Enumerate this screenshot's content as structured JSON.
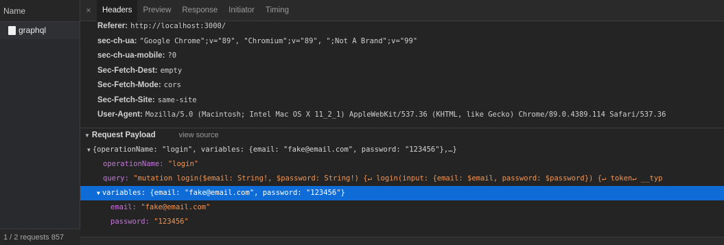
{
  "left": {
    "name_header": "Name",
    "requests": [
      {
        "name": "graphql"
      }
    ],
    "status": "1 / 2 requests  857"
  },
  "tabs": {
    "close": "×",
    "items": [
      "Headers",
      "Preview",
      "Response",
      "Initiator",
      "Timing"
    ],
    "active": "Headers"
  },
  "headers": [
    {
      "key": "Referer:",
      "value": "http://localhost:3000/"
    },
    {
      "key": "sec-ch-ua:",
      "value": "\"Google Chrome\";v=\"89\", \"Chromium\";v=\"89\", \";Not A Brand\";v=\"99\""
    },
    {
      "key": "sec-ch-ua-mobile:",
      "value": "?0"
    },
    {
      "key": "Sec-Fetch-Dest:",
      "value": "empty"
    },
    {
      "key": "Sec-Fetch-Mode:",
      "value": "cors"
    },
    {
      "key": "Sec-Fetch-Site:",
      "value": "same-site"
    },
    {
      "key": "User-Agent:",
      "value": "Mozilla/5.0 (Macintosh; Intel Mac OS X 11_2_1) AppleWebKit/537.36 (KHTML, like Gecko) Chrome/89.0.4389.114 Safari/537.36"
    }
  ],
  "payload": {
    "title": "Request Payload",
    "view_source": "view source",
    "summary": "{operationName: \"login\", variables: {email: \"fake@email.com\", password: \"123456\"},…}",
    "operationName_key": "operationName:",
    "operationName_val": "\"login\"",
    "query_key": "query:",
    "query_val": "\"mutation login($email: String!, $password: String!) {↵  login(input: {email: $email, password: $password}) {↵    token↵    __typ",
    "variables_summary": "variables: {email: \"fake@email.com\", password: \"123456\"}",
    "email_key": "email:",
    "email_val": "\"fake@email.com\"",
    "password_key": "password:",
    "password_val": "\"123456\""
  },
  "colors": {
    "selection": "#0f6cd6",
    "key": "#c476d9",
    "string": "#f09656"
  }
}
